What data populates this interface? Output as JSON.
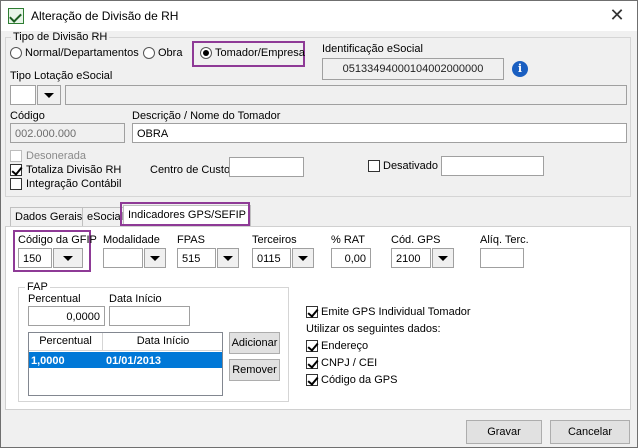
{
  "window": {
    "title": "Alteração de Divisão de RH",
    "close_glyph": "✕"
  },
  "tipo_divisao": {
    "legend": "Tipo de Divisão RH",
    "options": [
      "Normal/Departamentos",
      "Obra",
      "Tomador/Empresa"
    ],
    "selected": "Tomador/Empresa"
  },
  "identificacao": {
    "label": "Identificação eSocial",
    "value": "05133494000104002000000",
    "info_glyph": "i"
  },
  "tipo_lotacao": {
    "label": "Tipo Lotação eSocial",
    "value": "",
    "desc": ""
  },
  "codigo": {
    "label": "Código",
    "value": "002.000.000"
  },
  "descricao": {
    "label": "Descrição / Nome do Tomador",
    "value": "OBRA"
  },
  "checks": {
    "desonerada": {
      "label": "Desonerada",
      "checked": false
    },
    "totaliza": {
      "label": "Totaliza Divisão RH",
      "checked": true
    },
    "integracao": {
      "label": "Integração Contábil",
      "checked": false
    }
  },
  "centro_custo": {
    "label": "Centro de Custo",
    "value": ""
  },
  "desativado": {
    "label": "Desativado",
    "value": ""
  },
  "tabs": [
    "Dados Gerais",
    "eSocial",
    "Indicadores GPS/SEFIP"
  ],
  "active_tab": "Indicadores GPS/SEFIP",
  "gps": {
    "codigo_gfip": {
      "label": "Código da GFIP",
      "value": "150"
    },
    "modalidade": {
      "label": "Modalidade",
      "value": ""
    },
    "fpas": {
      "label": "FPAS",
      "value": "515"
    },
    "terceiros": {
      "label": "Terceiros",
      "value": "0115"
    },
    "rat": {
      "label": "% RAT",
      "value": "0,00"
    },
    "cod_gps": {
      "label": "Cód. GPS",
      "value": "2100"
    },
    "aliq_terc": {
      "label": "Alíq. Terc.",
      "value": ""
    }
  },
  "fap": {
    "legend": "FAP",
    "percentual_label": "Percentual",
    "percentual_value": "0,0000",
    "data_inicio_label": "Data Início",
    "data_inicio_value": "",
    "table": {
      "headers": [
        "Percentual",
        "Data Início"
      ],
      "rows": [
        [
          "1,0000",
          "01/01/2013"
        ]
      ]
    },
    "add_label": "Adicionar",
    "remove_label": "Remover"
  },
  "emite": {
    "label": "Emite GPS Individual Tomador",
    "checked": true
  },
  "utilizar": {
    "label": "Utilizar os seguintes dados:",
    "items": [
      {
        "label": "Endereço",
        "checked": true
      },
      {
        "label": "CNPJ / CEI",
        "checked": true
      },
      {
        "label": "Código da GPS",
        "checked": true
      }
    ]
  },
  "footer": {
    "gravar": "Gravar",
    "cancelar": "Cancelar"
  },
  "colors": {
    "highlight": "#8e3a96",
    "selection": "#0078d7",
    "info": "#1a5fc1"
  }
}
